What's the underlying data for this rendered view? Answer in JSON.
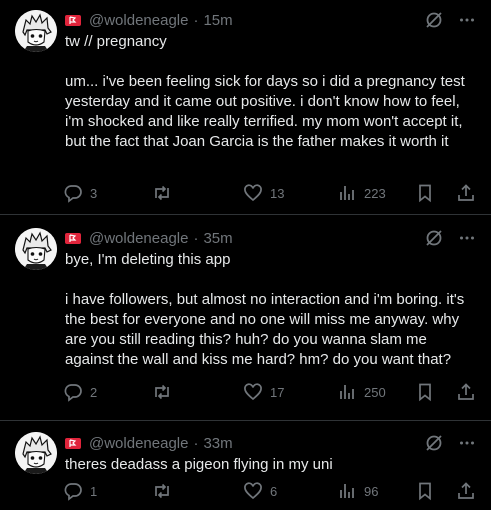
{
  "colors": {
    "background": "#000000",
    "text": "#e7e9ea",
    "muted": "#71767b",
    "divider": "#2f3336",
    "flag": "#e0243b"
  },
  "posts": [
    {
      "handle": "@woldeneagle",
      "separator": "·",
      "time": "15m",
      "text": "tw // pregnancy\n\num... i've been feeling sick for days so i did a pregnancy test yesterday and it came out positive. i don't know how to feel, i'm shocked and like really terrified. my mom won't accept it, but the fact that Joan Garcia is the father makes it worth it",
      "replies": "3",
      "reposts": "",
      "likes": "13",
      "views": "223"
    },
    {
      "handle": "@woldeneagle",
      "separator": "·",
      "time": "35m",
      "text": "bye, I'm deleting this app\n\ni have followers, but almost no interaction and i'm boring. it's the best for everyone and no one will miss me anyway. why are you still reading this? huh? do you wanna slam me against the wall and kiss me hard? hm? do you want that?",
      "replies": "2",
      "reposts": "",
      "likes": "17",
      "views": "250"
    },
    {
      "handle": "@woldeneagle",
      "separator": "·",
      "time": "33m",
      "text": "theres deadass a pigeon flying in my uni",
      "replies": "1",
      "reposts": "",
      "likes": "6",
      "views": "96"
    }
  ],
  "icons": {
    "avatar": "anime-avatar",
    "flag": "red-flag-badge",
    "grok": "grok-icon",
    "more": "more-icon",
    "reply": "reply-icon",
    "repost": "repost-icon",
    "like": "like-icon",
    "views": "views-icon",
    "bookmark": "bookmark-icon",
    "share": "share-icon"
  }
}
